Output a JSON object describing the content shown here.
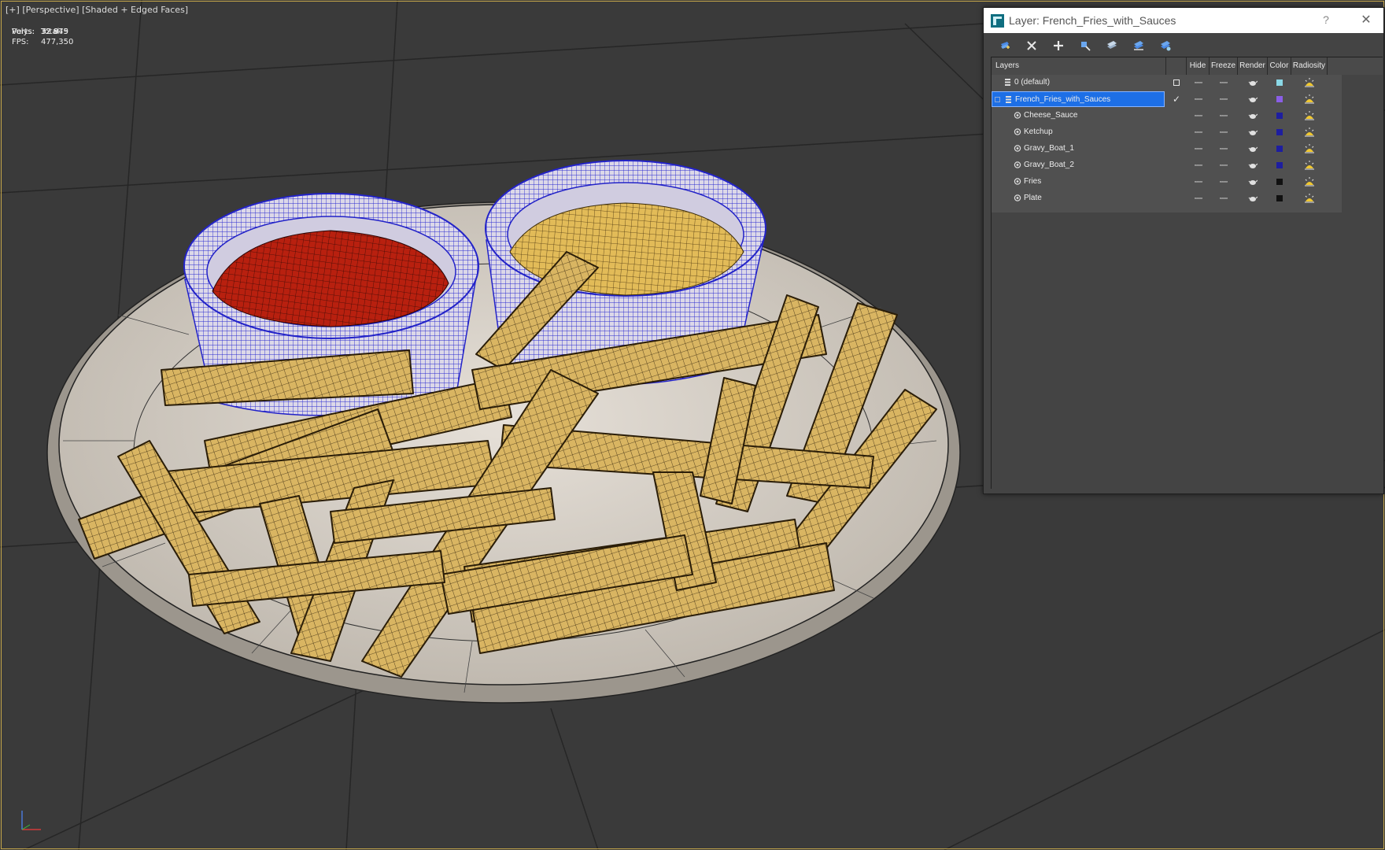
{
  "viewport": {
    "labels": [
      "[+]",
      "[Perspective]",
      "[Shaded + Edged Faces]"
    ],
    "stats": {
      "total_label": "Total",
      "polys_label": "Polys:",
      "polys_value": "32 875",
      "verts_label": "Verts:",
      "verts_value": "32 949",
      "fps_label": "FPS:",
      "fps_value": "477,350"
    },
    "axis_gizmo": {
      "x_color": "#d23a3a",
      "z_color": "#4a78d6"
    },
    "colors": {
      "frame": "#c5a64a",
      "stats_text": "#e6d37a",
      "background": "#3a3a3a"
    }
  },
  "layer_dialog": {
    "title": "Layer: French_Fries_with_Sauces",
    "help": "?",
    "close": "✕",
    "toolbar": [
      "new-layer-icon",
      "delete-layer-icon",
      "add-to-layer-icon",
      "select-objects-icon",
      "highlight-layer-icon",
      "hide-all-icon",
      "freeze-all-icon"
    ],
    "columns": [
      "Layers",
      "Hide",
      "Freeze",
      "Render",
      "Color",
      "Radiosity"
    ],
    "rows": [
      {
        "name": "0 (default)",
        "type": "layer",
        "current": "box",
        "color": "#8ad8e6"
      },
      {
        "name": "French_Fries_with_Sauces",
        "type": "layer",
        "current": "check",
        "selected": true,
        "color": "#8a5ee6"
      },
      {
        "name": "Cheese_Sauce",
        "type": "object",
        "color": "#1e1ea0"
      },
      {
        "name": "Ketchup",
        "type": "object",
        "color": "#1e1ea0"
      },
      {
        "name": "Gravy_Boat_1",
        "type": "object",
        "color": "#1e1ea0"
      },
      {
        "name": "Gravy_Boat_2",
        "type": "object",
        "color": "#1e1ea0"
      },
      {
        "name": "Fries",
        "type": "object",
        "color": "#111111"
      },
      {
        "name": "Plate",
        "type": "object",
        "color": "#111111"
      }
    ],
    "colors": {
      "selection": "#1d6fe6",
      "panel": "#444444"
    }
  }
}
